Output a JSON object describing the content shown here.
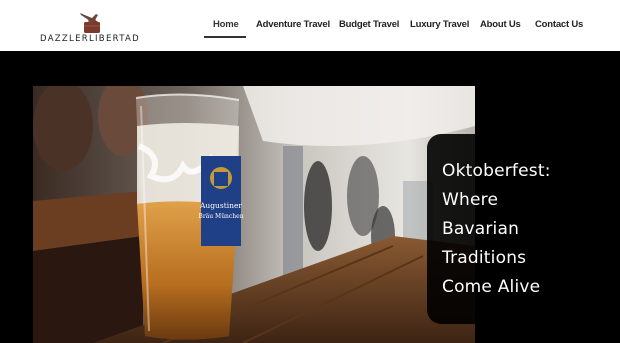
{
  "brand": {
    "name": "DAZZLERLIBERTAD"
  },
  "nav": {
    "items": [
      {
        "label": "Home",
        "active": true
      },
      {
        "label": "Adventure Travel"
      },
      {
        "label": "Budget Travel"
      },
      {
        "label": "Luxury Travel"
      },
      {
        "label": "About Us"
      },
      {
        "label": "Contact Us"
      }
    ]
  },
  "hero": {
    "glass_text_1": "Augustiner",
    "glass_text_2": "Bräu München",
    "caption_lines": [
      "Oktoberfest:",
      "Where",
      "Bavarian",
      "Traditions",
      "Come Alive"
    ]
  }
}
